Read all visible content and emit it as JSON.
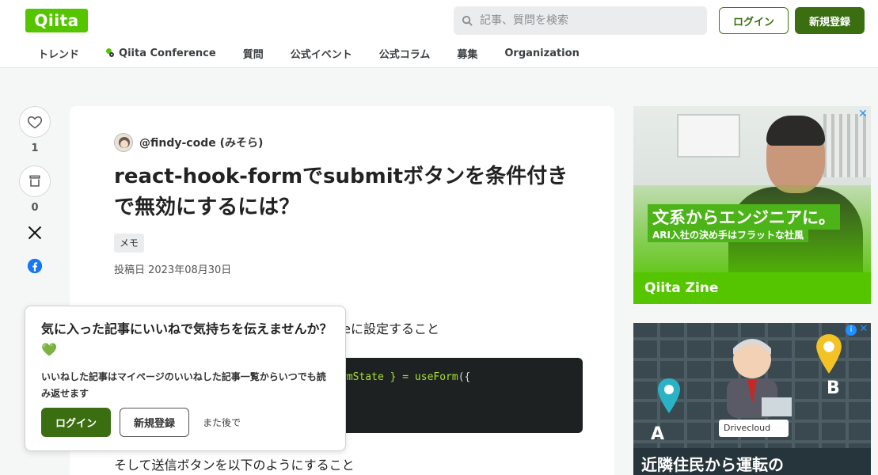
{
  "header": {
    "logo": "Qiita",
    "search_placeholder": "記事、質問を検索",
    "login_label": "ログイン",
    "signup_label": "新規登録"
  },
  "nav": {
    "items": [
      "トレンド",
      "Qiita Conference",
      "質問",
      "公式イベント",
      "公式コラム",
      "募集",
      "Organization"
    ]
  },
  "share": {
    "like_count": "1",
    "stock_count": "0"
  },
  "article": {
    "author": "@findy-code (みそら)",
    "title": "react-hook-formでsubmitボタンを条件付きで無効にするには？",
    "tag": "メモ",
    "posted": "投稿日 2023年08月30日",
    "body_fragment_1": "geに設定すること",
    "code_fragment_pre": "rmState } = ",
    "code_fragment_fn": "useForm",
    "code_fragment_post": "({",
    "body_fragment_2": "そして送信ボタンを以下のようにすること"
  },
  "popup": {
    "title": "気に入った記事にいいねで気持ちを伝えませんか？💚",
    "description": "いいねした記事はマイページのいいねした記事一覧からいつでも読み返せます",
    "login_label": "ログイン",
    "signup_label": "新規登録",
    "later_label": "また後で"
  },
  "ads": {
    "ad1_headline": "文系からエンジニアに。",
    "ad1_subline": "ARI入社の決め手はフラットな社風",
    "ad1_brand": "Qiita Zine",
    "ad2_headline": "近隣住民から運転の",
    "ad2_card": "Drivecloud",
    "ad2_label_a": "A",
    "ad2_label_b": "B"
  },
  "colors": {
    "brand_green": "#55c500",
    "dark_green": "#3a6e10"
  }
}
